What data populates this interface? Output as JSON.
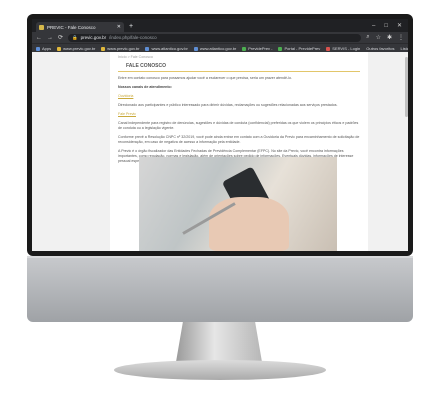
{
  "browser": {
    "tab_title": "PREVIC - Fale Conosco",
    "new_tab": "+",
    "window_controls": [
      "–",
      "□",
      "✕"
    ],
    "url_domain": "previc.gov.br",
    "url_path": "/index.php/fale-conosco",
    "bookmarks": [
      {
        "label": "Apps",
        "color": "#5f8fd6"
      },
      {
        "label": "www.previc.gov.br",
        "color": "#e0b83c"
      },
      {
        "label": "www.previc.gov.br",
        "color": "#e0b83c"
      },
      {
        "label": "www.atlantico.gov.br",
        "color": "#5f8fd6"
      },
      {
        "label": "www.atlantico.gov.br",
        "color": "#5f8fd6"
      },
      {
        "label": "PrevidePrev -",
        "color": "#4caf50"
      },
      {
        "label": "Portal - PrevidePrev",
        "color": "#4caf50"
      },
      {
        "label": "SERVIS - Login",
        "color": "#d9534f"
      }
    ],
    "bookmarks_right": [
      "Outros favoritos",
      "Lista de leitura"
    ]
  },
  "page": {
    "breadcrumb": "Início > Fale Conosco",
    "title": "FALE CONOSCO",
    "intro": "Entre em contato conosco para possamos ajudar você a esclarecer o que precisa, seria um prazer atendê-lo.",
    "section_heading": "Nossos canais de atendimento:",
    "link_ouvidoria": "Ouvidoria",
    "para_ouvidoria": "Direcionado aos participantes e público interessado para dirimir dúvidas, reclamações ou sugestões relacionadas aos serviços prestados.",
    "link_fale": "Fale Previc",
    "para_fale": "Canal independente para registro de denúncias, sugestões e dúvidas de conduta (confidencial) preferidas os que violem os princípios éticos e padrões de conduta ou a legislação vigente.",
    "para_lei": "Conforme prevê a Resolução CNPC nº 32/2019, você pode ainda entrar em contato com a Ouvidoria da Previc para encaminhamento de solicitação de reconsideração, em caso de negativa de acesso a informação pela entidade.",
    "para_previc": "A Previc é o órgão fiscalizador das Entidades Fechadas de Previdência Complementar (EFPC). No site da Previc, você encontra informações importantes, como regulação, normas e legislação, além de orientações sobre pedido de informações. Eventuais dúvidas, informações de interesse pessoal específico do participante devem ser requisitadas junto à respectiva entidade."
  }
}
